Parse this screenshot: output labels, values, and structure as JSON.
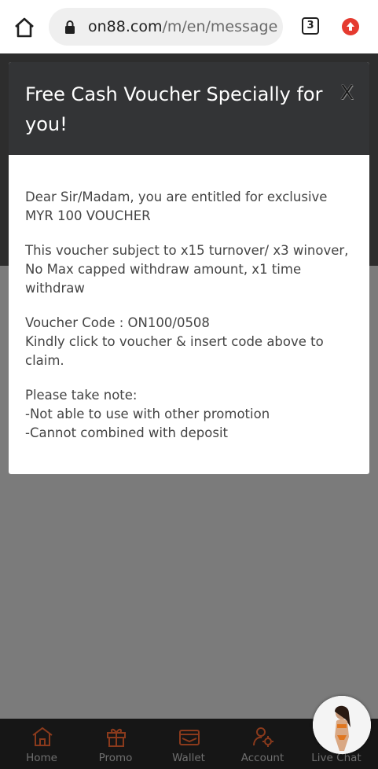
{
  "browser": {
    "url_host": "on88.com",
    "url_path": "/m/en/message",
    "tab_count": "3"
  },
  "modal": {
    "title": "Free Cash Voucher Specially for you!",
    "close_label": "X",
    "paragraphs": [
      [
        "Dear Sir/Madam, you are entitled for exclusive",
        "MYR 100 VOUCHER"
      ],
      [
        "This voucher subject to x15 turnover/ x3 winover,",
        "No Max capped withdraw amount, x1 time",
        "withdraw"
      ],
      [
        "Voucher Code : ON100/0508",
        "Kindly click to voucher & insert code above to",
        "claim."
      ],
      [
        "Please take note:",
        "-Not able to use with other promotion",
        "-Cannot combined with deposit"
      ]
    ]
  },
  "bottom_nav": {
    "items": [
      {
        "label": "Home",
        "icon": "home-icon"
      },
      {
        "label": "Promo",
        "icon": "gift-icon"
      },
      {
        "label": "Wallet",
        "icon": "wallet-icon"
      },
      {
        "label": "Account",
        "icon": "account-settings-icon"
      },
      {
        "label": "Live Chat",
        "icon": "chat-icon"
      }
    ]
  },
  "colors": {
    "nav_icon": "#8a3a1c",
    "modal_header": "#333436",
    "update_badge": "#e53a2f"
  }
}
